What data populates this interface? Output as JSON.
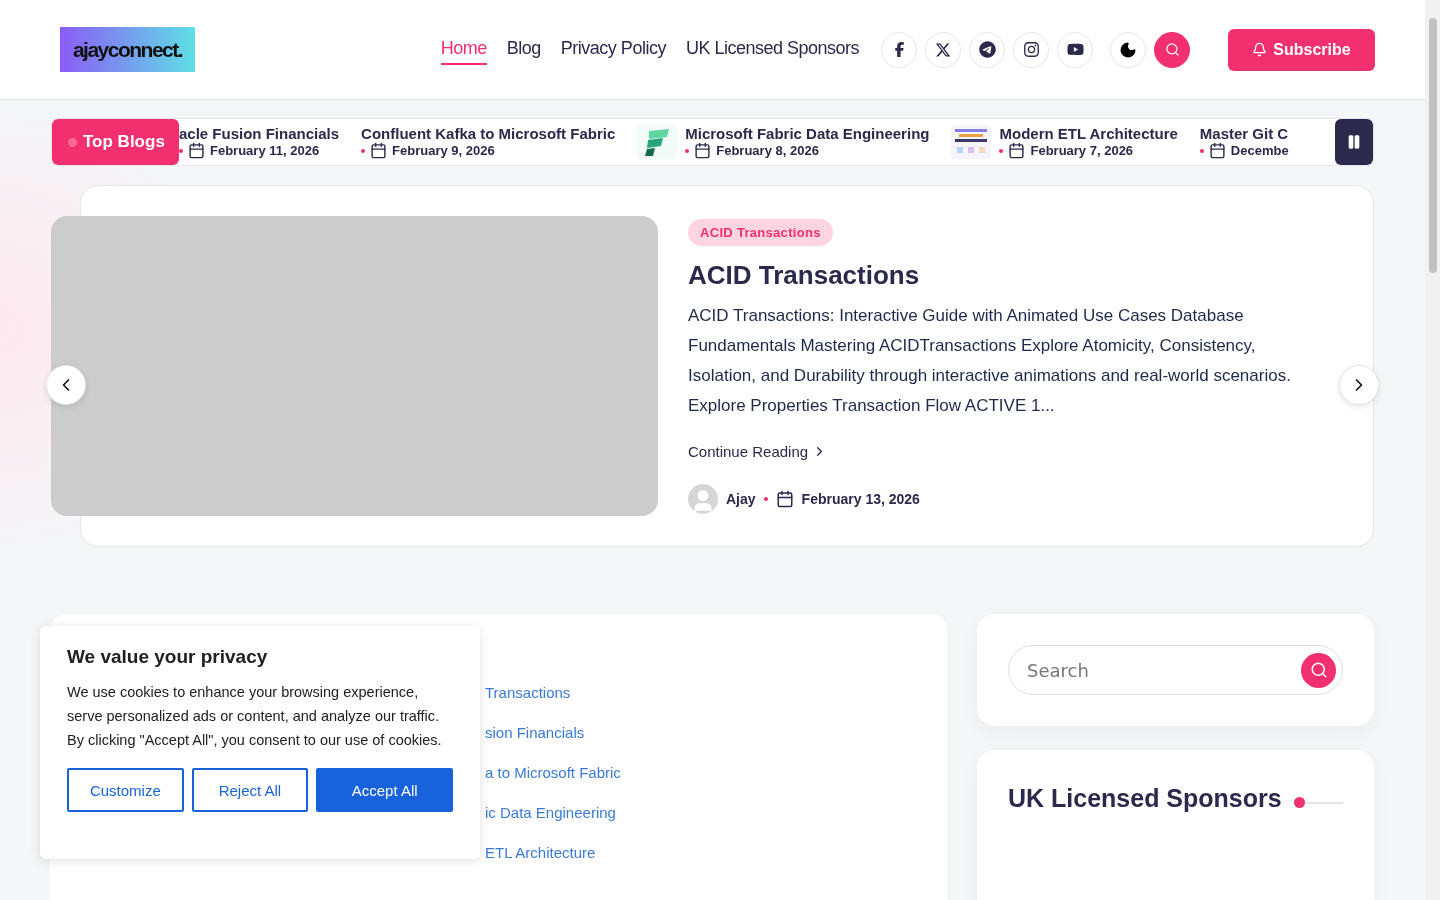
{
  "header": {
    "logo": "ajayconnect.",
    "nav": [
      {
        "label": "Home",
        "selected": true
      },
      {
        "label": "Blog",
        "selected": false
      },
      {
        "label": "Privacy Policy",
        "selected": false
      },
      {
        "label": "UK Licensed Sponsors",
        "selected": false
      }
    ],
    "social": [
      {
        "kind": "facebook"
      },
      {
        "kind": "x"
      },
      {
        "kind": "telegram"
      },
      {
        "kind": "instagram"
      },
      {
        "kind": "youtube"
      }
    ],
    "subscribe": "Subscribe"
  },
  "ticker": {
    "label": "Top Blogs",
    "items": [
      {
        "title": "acle Fusion Financials",
        "date": "February 11, 2026",
        "thumbnail": false
      },
      {
        "title": "Confluent Kafka to Microsoft Fabric",
        "date": "February 9, 2026",
        "thumbnail": false
      },
      {
        "title": "Microsoft Fabric Data Engineering",
        "date": "February 8, 2026",
        "thumbnail": true
      },
      {
        "title": "Modern ETL Architecture",
        "date": "February 7, 2026",
        "thumbnail": true
      },
      {
        "title": "Master Git C",
        "date": "Decembe",
        "thumbnail": false
      }
    ]
  },
  "hero": {
    "tag": "ACID Transactions",
    "title": "ACID Transactions",
    "excerpt": "ACID Transactions: Interactive Guide with Animated Use Cases Database Fundamentals Mastering ACIDTransactions Explore Atomicity, Consistency, Isolation, and Durability through interactive animations and real-world scenarios. Explore Properties Transaction Flow ACTIVE 1...",
    "continue": "Continue Reading",
    "author": "Ajay",
    "date": "February 13, 2026"
  },
  "post_list": {
    "items": [
      "Transactions",
      "sion Financials",
      "a to Microsoft Fabric",
      "ic Data Engineering",
      "ETL Architecture"
    ]
  },
  "sidebar": {
    "search": {
      "placeholder": "Search"
    },
    "widget_title": "UK Licensed Sponsors"
  },
  "cookie": {
    "title": "We value your privacy",
    "text": "We use cookies to enhance your browsing experience, serve personalized ads or content, and analyze our traffic. By clicking \"Accept All\", you consent to our use of cookies.",
    "buttons": [
      {
        "label": "Customize",
        "kind": "outline"
      },
      {
        "label": "Reject All",
        "kind": "outline"
      },
      {
        "label": "Accept All",
        "kind": "primary"
      }
    ]
  }
}
